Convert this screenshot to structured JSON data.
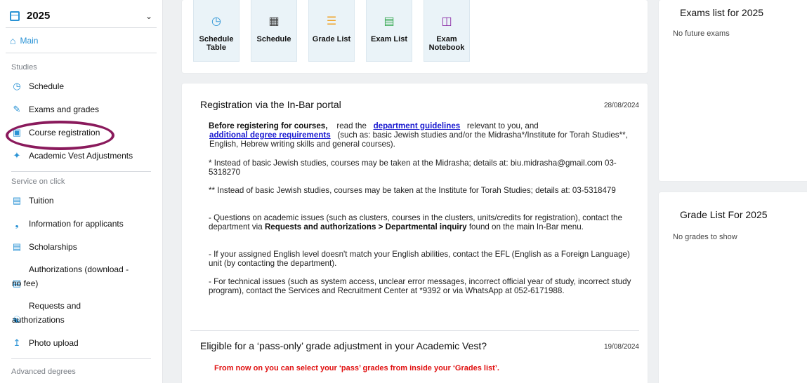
{
  "sidebar": {
    "year": "2025",
    "main_label": "Main",
    "sections": {
      "studies": "Studies",
      "service": "Service on click",
      "advanced": "Advanced degrees"
    },
    "items": {
      "schedule": "Schedule",
      "exams": "Exams and grades",
      "course_registration": "Course registration",
      "vest": "Academic Vest Adjustments",
      "tuition": "Tuition",
      "applicants": "Information for applicants",
      "scholarships": "Scholarships",
      "auth_line1": "Authorizations (download -",
      "auth_line2": "no fee)",
      "requests_line1": "Requests and",
      "requests_line2": "authorizations",
      "photo": "Photo upload"
    }
  },
  "quick_links": [
    {
      "line1": "Schedule",
      "line2": "Table",
      "icon": "clock-icon",
      "color": "#2a93d5"
    },
    {
      "line1": "Schedule",
      "line2": "",
      "icon": "calendar-icon",
      "color": "#444444"
    },
    {
      "line1": "Grade List",
      "line2": "",
      "icon": "list-icon",
      "color": "#f0a020"
    },
    {
      "line1": "Exam List",
      "line2": "",
      "icon": "exam-list-icon",
      "color": "#3aaa55"
    },
    {
      "line1": "Exam",
      "line2": "Notebook",
      "icon": "notebook-icon",
      "color": "#8a2aa5"
    }
  ],
  "news": [
    {
      "title": "Registration via the In-Bar portal",
      "date": "28/08/2024",
      "p1_bold": "Before registering for courses,",
      "p1_a": "read the",
      "p1_link1": "department guidelines",
      "p1_b": "relevant to you, and",
      "p1_link2": "additional degree requirements",
      "p1_c": "(such as: basic Jewish studies and/or the Midrasha*/Institute for Torah Studies**, English, Hebrew writing skills and general courses).",
      "p2": "* Instead of basic Jewish studies, courses may be taken at the Midrasha; details at: biu.midrasha@gmail.com 03-5318270",
      "p3": "** Instead of basic Jewish studies, courses may be taken at the Institute for Torah Studies; details at: 03-5318479",
      "p4_a": "- Questions on academic issues (such as clusters, courses in the clusters, units/credits for registration), contact the department via",
      "p4_bold": "Requests and authorizations > Departmental inquiry",
      "p4_b": "found on the main In-Bar menu.",
      "p5": "- If your assigned English level doesn't match your English abilities, contact the EFL (English as a Foreign Language) unit (by contacting the department).",
      "p6": "- For technical issues (such as system access, unclear error messages, incorrect official year of study, incorrect study program), contact the Services and Recruitment Center at *9392 or via WhatsApp at 052-6171988."
    },
    {
      "title": "Eligible for a ‘pass-only’ grade adjustment in your Academic Vest?",
      "date": "19/08/2024",
      "highlight": "From now on you can select your ‘pass’ grades  from inside  your ‘Grades list’."
    }
  ],
  "exams_panel": {
    "title": "Exams list for 2025",
    "empty": "No future exams"
  },
  "grades_panel": {
    "title": "Grade List For 2025",
    "empty": "No grades to show"
  }
}
